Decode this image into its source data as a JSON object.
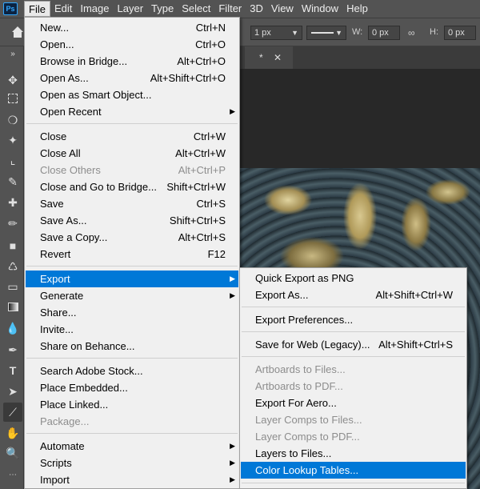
{
  "menubar": {
    "logo": "Ps",
    "items": [
      "File",
      "Edit",
      "Image",
      "Layer",
      "Type",
      "Select",
      "Filter",
      "3D",
      "View",
      "Window",
      "Help"
    ]
  },
  "options": {
    "stroke_width": "1 px",
    "w_label": "W:",
    "w_value": "0 px",
    "h_label": "H:",
    "h_value": "0 px"
  },
  "document": {
    "tab_suffix": "*"
  },
  "file_menu": {
    "new": {
      "label": "New...",
      "shortcut": "Ctrl+N"
    },
    "open": {
      "label": "Open...",
      "shortcut": "Ctrl+O"
    },
    "browse_bridge": {
      "label": "Browse in Bridge...",
      "shortcut": "Alt+Ctrl+O"
    },
    "open_as": {
      "label": "Open As...",
      "shortcut": "Alt+Shift+Ctrl+O"
    },
    "open_smart": {
      "label": "Open as Smart Object..."
    },
    "open_recent": {
      "label": "Open Recent"
    },
    "close": {
      "label": "Close",
      "shortcut": "Ctrl+W"
    },
    "close_all": {
      "label": "Close All",
      "shortcut": "Alt+Ctrl+W"
    },
    "close_others": {
      "label": "Close Others",
      "shortcut": "Alt+Ctrl+P"
    },
    "close_bridge": {
      "label": "Close and Go to Bridge...",
      "shortcut": "Shift+Ctrl+W"
    },
    "save": {
      "label": "Save",
      "shortcut": "Ctrl+S"
    },
    "save_as": {
      "label": "Save As...",
      "shortcut": "Shift+Ctrl+S"
    },
    "save_copy": {
      "label": "Save a Copy...",
      "shortcut": "Alt+Ctrl+S"
    },
    "revert": {
      "label": "Revert",
      "shortcut": "F12"
    },
    "export": {
      "label": "Export"
    },
    "generate": {
      "label": "Generate"
    },
    "share": {
      "label": "Share..."
    },
    "invite": {
      "label": "Invite..."
    },
    "behance": {
      "label": "Share on Behance..."
    },
    "stock": {
      "label": "Search Adobe Stock..."
    },
    "place_embedded": {
      "label": "Place Embedded..."
    },
    "place_linked": {
      "label": "Place Linked..."
    },
    "package": {
      "label": "Package..."
    },
    "automate": {
      "label": "Automate"
    },
    "scripts": {
      "label": "Scripts"
    },
    "import": {
      "label": "Import"
    }
  },
  "export_menu": {
    "quick_png": {
      "label": "Quick Export as PNG"
    },
    "export_as": {
      "label": "Export As...",
      "shortcut": "Alt+Shift+Ctrl+W"
    },
    "prefs": {
      "label": "Export Preferences..."
    },
    "save_web": {
      "label": "Save for Web (Legacy)...",
      "shortcut": "Alt+Shift+Ctrl+S"
    },
    "artboards_files": {
      "label": "Artboards to Files..."
    },
    "artboards_pdf": {
      "label": "Artboards to PDF..."
    },
    "aero": {
      "label": "Export For Aero..."
    },
    "comps_files": {
      "label": "Layer Comps to Files..."
    },
    "comps_pdf": {
      "label": "Layer Comps to PDF..."
    },
    "layers_files": {
      "label": "Layers to Files..."
    },
    "lut": {
      "label": "Color Lookup Tables..."
    }
  },
  "colors": {
    "highlight": "#0078d7",
    "menu_bg": "#f0f0f0",
    "ui_bg": "#535353"
  }
}
